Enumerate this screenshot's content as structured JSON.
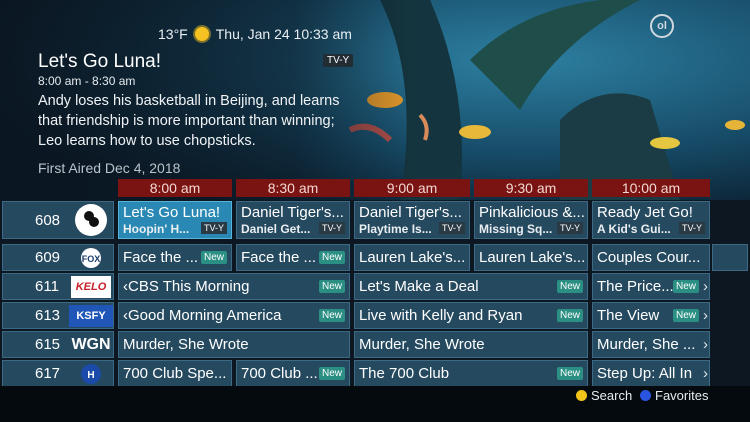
{
  "status": {
    "temperature": "13°F",
    "datetime": "Thu, Jan 24 10:33 am",
    "weather_icon": "sun-icon"
  },
  "program": {
    "title": "Let's Go Luna!",
    "rating": "TV-Y",
    "time_range": "8:00 am - 8:30 am",
    "description": "Andy loses his basketball in Beijing, and learns that friendship is more important than winning; Leo learns how to use chopsticks.",
    "first_aired": "First Aired Dec 4, 2018"
  },
  "timeslots": [
    "8:00 am",
    "8:30 am",
    "9:00 am",
    "9:30 am",
    "10:00 am"
  ],
  "channels": [
    {
      "number": "608",
      "logo": "PBS",
      "programs": [
        {
          "title": "Let's Go Luna!",
          "sub": "Hoopin' H...",
          "rating": "TV-Y"
        },
        {
          "title": "Daniel Tiger's...",
          "sub": "Daniel Get...",
          "rating": "TV-Y"
        },
        {
          "title": "Daniel Tiger's...",
          "sub": "Playtime Is...",
          "rating": "TV-Y"
        },
        {
          "title": "Pinkalicious &...",
          "sub": "Missing Sq...",
          "rating": "TV-Y"
        },
        {
          "title": "Ready Jet Go!",
          "sub": "A Kid's Gui...",
          "rating": "TV-Y"
        }
      ]
    },
    {
      "number": "609",
      "logo": "FOX",
      "programs": [
        {
          "title": "Face the ...",
          "badge": "New"
        },
        {
          "title": "Face the ...",
          "badge": "New"
        },
        {
          "title": "Lauren Lake's..."
        },
        {
          "title": "Lauren Lake's..."
        },
        {
          "title": "Couples Cour..."
        }
      ]
    },
    {
      "number": "611",
      "logo": "KELO",
      "programs": [
        {
          "title": "CBS This Morning",
          "badge": "New"
        },
        {
          "title": "Let's Make a Deal",
          "badge": "New"
        },
        {
          "title": "The Price...",
          "badge": "New"
        }
      ]
    },
    {
      "number": "613",
      "logo": "KSFY",
      "programs": [
        {
          "title": "Good Morning America",
          "badge": "New"
        },
        {
          "title": "Live with Kelly and Ryan",
          "badge": "New"
        },
        {
          "title": "The View",
          "badge": "New"
        }
      ]
    },
    {
      "number": "615",
      "logo": "WGN",
      "programs": [
        {
          "title": "Murder, She Wrote"
        },
        {
          "title": "Murder, She Wrote"
        },
        {
          "title": "Murder, She ..."
        }
      ]
    },
    {
      "number": "617",
      "logo": "H",
      "programs": [
        {
          "title": "700 Club Spe..."
        },
        {
          "title": "700 Club ...",
          "badge": "New"
        },
        {
          "title": "The 700 Club",
          "badge": "New"
        },
        {
          "title": "Step Up: All In"
        }
      ]
    }
  ],
  "legend": {
    "search": "Search",
    "favorites": "Favorites"
  },
  "colors": {
    "search_dot": "#f2c31b",
    "favorites_dot": "#2a55e0",
    "timebar": "#7a1412"
  }
}
